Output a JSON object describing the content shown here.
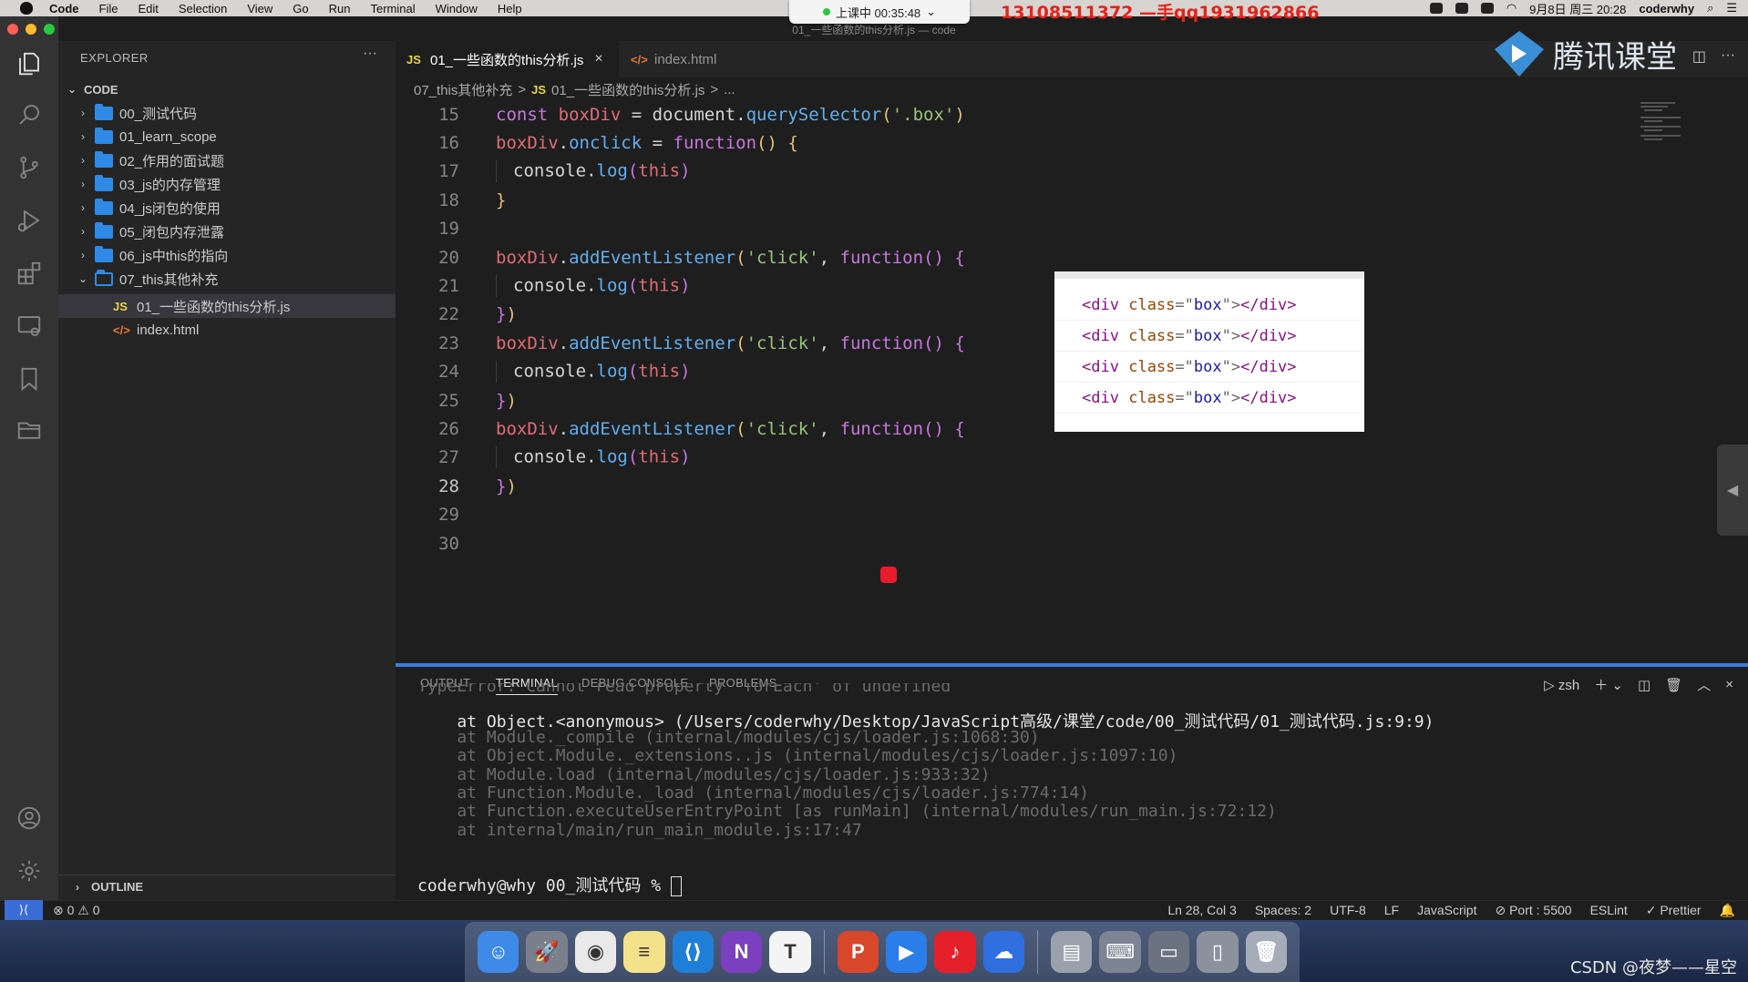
{
  "menubar": {
    "app": "Code",
    "items": [
      "File",
      "Edit",
      "Selection",
      "View",
      "Go",
      "Run",
      "Terminal",
      "Window",
      "Help"
    ],
    "recording": "上课中 00:35:48",
    "watermark": "13108511372 —手qq1931962866",
    "date": "9月8日 周三 20:28",
    "user": "coderwhy"
  },
  "window_title": "01_一些函数的this分析.js — code",
  "sidebar": {
    "title": "EXPLORER",
    "more": "···",
    "section": "CODE",
    "items": [
      {
        "label": "00_测试代码",
        "type": "folder"
      },
      {
        "label": "01_learn_scope",
        "type": "folder"
      },
      {
        "label": "02_作用的面试题",
        "type": "folder"
      },
      {
        "label": "03_js的内存管理",
        "type": "folder"
      },
      {
        "label": "04_js闭包的使用",
        "type": "folder"
      },
      {
        "label": "05_闭包内存泄露",
        "type": "folder"
      },
      {
        "label": "06_js中this的指向",
        "type": "folder"
      },
      {
        "label": "07_this其他补充",
        "type": "folder-open"
      },
      {
        "label": "01_一些函数的this分析.js",
        "type": "js"
      },
      {
        "label": "index.html",
        "type": "html"
      }
    ],
    "outline": "OUTLINE"
  },
  "tabs": [
    {
      "label": "01_一些函数的this分析.js",
      "icon": "JS"
    },
    {
      "label": "index.html",
      "icon": "</>"
    }
  ],
  "brand": "腾讯课堂",
  "breadcrumb": {
    "folder": "07_this其他补充",
    "sep": ">",
    "file": "01_一些函数的this分析.js",
    "more": "..."
  },
  "editor": {
    "lines": [
      {
        "n": "15",
        "tokens": [
          [
            "k-var",
            "const "
          ],
          [
            "k-id",
            "boxDiv"
          ],
          [
            "k-pun",
            " = "
          ],
          [
            "k-pun",
            "document."
          ],
          [
            "k-fn",
            "querySelector"
          ],
          [
            "k-br1",
            "("
          ],
          [
            "k-str",
            "'.box'"
          ],
          [
            "k-br1",
            ")"
          ]
        ]
      },
      {
        "n": "16",
        "tokens": [
          [
            "k-id",
            "boxDiv"
          ],
          [
            "k-pun",
            "."
          ],
          [
            "k-fn",
            "onclick"
          ],
          [
            "k-pun",
            " = "
          ],
          [
            "k-var",
            "function"
          ],
          [
            "k-br1",
            "() {"
          ]
        ]
      },
      {
        "n": "17",
        "indent": true,
        "tokens": [
          [
            "k-pun",
            "console."
          ],
          [
            "k-fn",
            "log"
          ],
          [
            "k-br2",
            "("
          ],
          [
            "k-id",
            "this"
          ],
          [
            "k-br2",
            ")"
          ]
        ]
      },
      {
        "n": "18",
        "tokens": [
          [
            "k-br1",
            "}"
          ]
        ]
      },
      {
        "n": "19",
        "tokens": []
      },
      {
        "n": "20",
        "tokens": [
          [
            "k-id",
            "boxDiv"
          ],
          [
            "k-pun",
            "."
          ],
          [
            "k-fn",
            "addEventListener"
          ],
          [
            "k-br1",
            "("
          ],
          [
            "k-str",
            "'click'"
          ],
          [
            "k-pun",
            ", "
          ],
          [
            "k-var",
            "function"
          ],
          [
            "k-br2",
            "() {"
          ]
        ]
      },
      {
        "n": "21",
        "indent": true,
        "tokens": [
          [
            "k-pun",
            "console."
          ],
          [
            "k-fn",
            "log"
          ],
          [
            "k-br2",
            "("
          ],
          [
            "k-id",
            "this"
          ],
          [
            "k-br2",
            ")"
          ]
        ]
      },
      {
        "n": "22",
        "tokens": [
          [
            "k-br2",
            "}"
          ],
          [
            "k-br1",
            ")"
          ]
        ]
      },
      {
        "n": "23",
        "tokens": [
          [
            "k-id",
            "boxDiv"
          ],
          [
            "k-pun",
            "."
          ],
          [
            "k-fn",
            "addEventListener"
          ],
          [
            "k-br1",
            "("
          ],
          [
            "k-str",
            "'click'"
          ],
          [
            "k-pun",
            ", "
          ],
          [
            "k-var",
            "function"
          ],
          [
            "k-br2",
            "() {"
          ]
        ]
      },
      {
        "n": "24",
        "indent": true,
        "tokens": [
          [
            "k-pun",
            "console."
          ],
          [
            "k-fn",
            "log"
          ],
          [
            "k-br2",
            "("
          ],
          [
            "k-id",
            "this"
          ],
          [
            "k-br2",
            ")"
          ]
        ]
      },
      {
        "n": "25",
        "tokens": [
          [
            "k-br2",
            "}"
          ],
          [
            "k-br1",
            ")"
          ]
        ]
      },
      {
        "n": "26",
        "tokens": [
          [
            "k-id",
            "boxDiv"
          ],
          [
            "k-pun",
            "."
          ],
          [
            "k-fn",
            "addEventListener"
          ],
          [
            "k-br1",
            "("
          ],
          [
            "k-str",
            "'click'"
          ],
          [
            "k-pun",
            ", "
          ],
          [
            "k-var",
            "function"
          ],
          [
            "k-br2",
            "() {"
          ]
        ]
      },
      {
        "n": "27",
        "indent": true,
        "tokens": [
          [
            "k-pun",
            "console."
          ],
          [
            "k-fn",
            "log"
          ],
          [
            "k-br2",
            "("
          ],
          [
            "k-id",
            "this"
          ],
          [
            "k-br2",
            ")"
          ]
        ]
      },
      {
        "n": "28",
        "current": true,
        "tokens": [
          [
            "k-br2",
            "}"
          ],
          [
            "k-br1",
            ")"
          ]
        ]
      },
      {
        "n": "29",
        "tokens": []
      },
      {
        "n": "30",
        "tokens": []
      }
    ]
  },
  "preview": {
    "tag": "div",
    "attr": "class",
    "value": "box",
    "count": 4
  },
  "panel": {
    "tabs": [
      "OUTPUT",
      "TERMINAL",
      "DEBUG CONSOLE",
      "PROBLEMS"
    ],
    "active_tab": "TERMINAL",
    "shell": "zsh",
    "lines": [
      {
        "style": "term-dim",
        "text": "TypeError: Cannot read property 'forEach' of undefined"
      },
      {
        "style": "term-bright",
        "text": "    at Object.<anonymous> (/Users/coderwhy/Desktop/JavaScript高级/课堂/code/00_测试代码/01_测试代码.js:9:9)"
      },
      {
        "style": "term-dim",
        "text": "    at Module._compile (internal/modules/cjs/loader.js:1068:30)"
      },
      {
        "style": "term-dim",
        "text": "    at Object.Module._extensions..js (internal/modules/cjs/loader.js:1097:10)"
      },
      {
        "style": "term-dim",
        "text": "    at Module.load (internal/modules/cjs/loader.js:933:32)"
      },
      {
        "style": "term-dim",
        "text": "    at Function.Module._load (internal/modules/cjs/loader.js:774:14)"
      },
      {
        "style": "term-dim",
        "text": "    at Function.executeUserEntryPoint [as runMain] (internal/modules/run_main.js:72:12)"
      },
      {
        "style": "term-dim",
        "text": "    at internal/main/run_main_module.js:17:47"
      }
    ],
    "prompt": "coderwhy@why 00_测试代码 % "
  },
  "statusbar": {
    "problems": "⊗ 0 ⚠ 0",
    "right": [
      "Ln 28, Col 3",
      "Spaces: 2",
      "UTF-8",
      "LF",
      "JavaScript",
      "⊘ Port : 5500",
      "ESLint",
      "✓ Prettier"
    ]
  },
  "dock_icons": [
    {
      "name": "finder",
      "color": "#3d8ae8",
      "glyph": "☺"
    },
    {
      "name": "launchpad",
      "color": "#7a7f8c",
      "glyph": "🚀"
    },
    {
      "name": "chrome",
      "color": "#e9e9e9",
      "glyph": "◉"
    },
    {
      "name": "notes",
      "color": "#f3e28a",
      "glyph": "≡"
    },
    {
      "name": "vscode",
      "color": "#1f7fd8",
      "glyph": "⟨⟩"
    },
    {
      "name": "onenote",
      "color": "#7b3fbf",
      "glyph": "N"
    },
    {
      "name": "typora",
      "color": "#f4f4f4",
      "glyph": "T"
    },
    {
      "name": "powerpoint",
      "color": "#d9472b",
      "glyph": "P"
    },
    {
      "name": "tencent-class",
      "color": "#2b7de9",
      "glyph": "▶"
    },
    {
      "name": "netease-music",
      "color": "#e6202a",
      "glyph": "♪"
    },
    {
      "name": "baidu-disk",
      "color": "#2f6fe0",
      "glyph": "☁"
    },
    {
      "name": "preview",
      "color": "#9aa1ad",
      "glyph": "▤"
    },
    {
      "name": "keyboard",
      "color": "#7d8594",
      "glyph": "⌨"
    },
    {
      "name": "screen",
      "color": "#6c7380",
      "glyph": "▭"
    },
    {
      "name": "device",
      "color": "#8b929e",
      "glyph": "▯"
    },
    {
      "name": "trash",
      "color": "#a7adb8",
      "glyph": "🗑"
    }
  ],
  "csdn": "CSDN @夜梦——星空",
  "colors": {
    "accent": "#3b6dd8",
    "folder": "#2e8ae6",
    "panel_border": "#3a7ddc"
  }
}
